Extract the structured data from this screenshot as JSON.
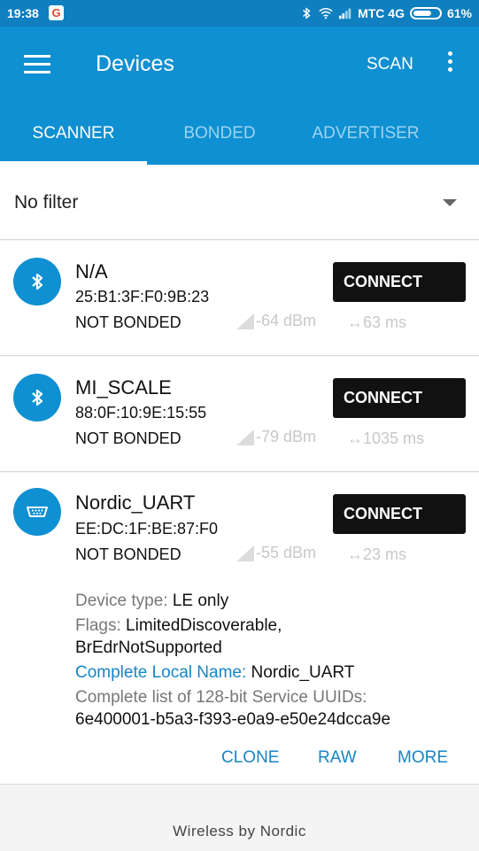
{
  "statusbar": {
    "time": "19:38",
    "g_letter": "G",
    "carrier": "МТС 4G",
    "battery": "61%"
  },
  "appbar": {
    "title": "Devices",
    "scan_label": "SCAN",
    "tabs": [
      {
        "label": "SCANNER",
        "active": true
      },
      {
        "label": "BONDED",
        "active": false
      },
      {
        "label": "ADVERTISER",
        "active": false
      }
    ]
  },
  "filter": {
    "label": "No filter"
  },
  "devices": [
    {
      "name": "N/A",
      "address": "25:B1:3F:F0:9B:23",
      "bond": "NOT BONDED",
      "rssi": "-64 dBm",
      "interval": "↔63 ms",
      "connect_label": "CONNECT",
      "icon": "bluetooth-icon"
    },
    {
      "name": "MI_SCALE",
      "address": "88:0F:10:9E:15:55",
      "bond": "NOT BONDED",
      "rssi": "-79 dBm",
      "interval": "↔1035 ms",
      "connect_label": "CONNECT",
      "icon": "bluetooth-icon"
    },
    {
      "name": "Nordic_UART",
      "address": "EE:DC:1F:BE:87:F0",
      "bond": "NOT BONDED",
      "rssi": "-55 dBm",
      "interval": "↔23 ms",
      "connect_label": "CONNECT",
      "icon": "serial-port-icon"
    }
  ],
  "details": {
    "device_type_key": "Device type:",
    "device_type_value": "LE only",
    "flags_key": "Flags:",
    "flags_value_1": "LimitedDiscoverable,",
    "flags_value_2": "BrEdrNotSupported",
    "local_name_key": "Complete Local Name:",
    "local_name_value": "Nordic_UART",
    "uuids_key": "Complete list of 128-bit Service UUIDs:",
    "uuids_value": "6e400001-b5a3-f393-e0a9-e50e24dcca9e"
  },
  "actions": {
    "clone": "CLONE",
    "raw": "RAW",
    "more": "MORE"
  },
  "footer": {
    "text": "Wireless by Nordic"
  }
}
